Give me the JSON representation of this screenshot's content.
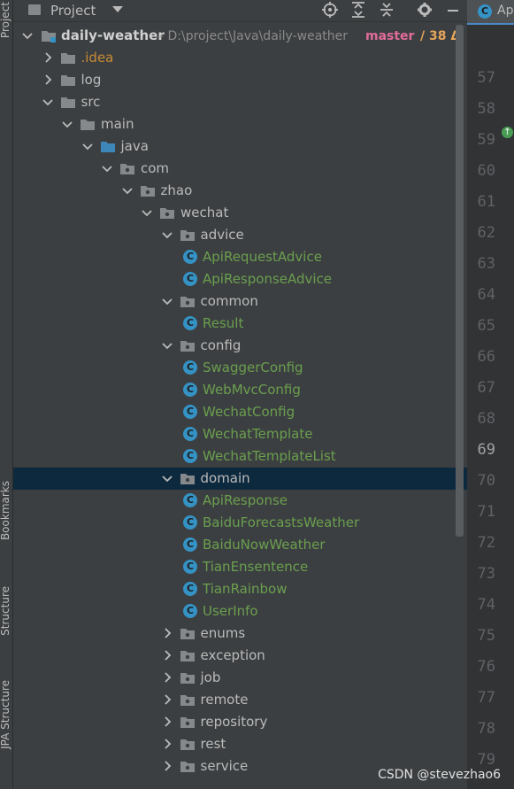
{
  "side_tabs": {
    "project": "Project",
    "bookmarks": "Bookmarks",
    "structure": "Structure",
    "jpa_structure": "JPA Structure"
  },
  "toolbar": {
    "title": "Project",
    "icons": [
      "locate-icon",
      "expand-all-icon",
      "collapse-all-icon",
      "gear-icon",
      "hide-icon"
    ]
  },
  "root": {
    "name": "daily-weather",
    "path": " - D:\\project\\Java\\daily-weather",
    "branch": "master",
    "changes": "/ 38 Δ"
  },
  "tree": [
    {
      "label": ".idea",
      "type": "folder",
      "depth": 1,
      "expanded": false,
      "color": "orange"
    },
    {
      "label": "log",
      "type": "folder",
      "depth": 1,
      "expanded": false
    },
    {
      "label": "src",
      "type": "folder",
      "depth": 1,
      "expanded": true
    },
    {
      "label": "main",
      "type": "folder",
      "depth": 2,
      "expanded": true
    },
    {
      "label": "java",
      "type": "source",
      "depth": 3,
      "expanded": true
    },
    {
      "label": "com",
      "type": "package",
      "depth": 4,
      "expanded": true
    },
    {
      "label": "zhao",
      "type": "package",
      "depth": 5,
      "expanded": true
    },
    {
      "label": "wechat",
      "type": "package",
      "depth": 6,
      "expanded": true
    },
    {
      "label": "advice",
      "type": "package",
      "depth": 7,
      "expanded": true
    },
    {
      "label": "ApiRequestAdvice",
      "type": "class",
      "depth": 8
    },
    {
      "label": "ApiResponseAdvice",
      "type": "class",
      "depth": 8
    },
    {
      "label": "common",
      "type": "package",
      "depth": 7,
      "expanded": true
    },
    {
      "label": "Result",
      "type": "class",
      "depth": 8
    },
    {
      "label": "config",
      "type": "package",
      "depth": 7,
      "expanded": true
    },
    {
      "label": "SwaggerConfig",
      "type": "class",
      "depth": 8
    },
    {
      "label": "WebMvcConfig",
      "type": "class",
      "depth": 8
    },
    {
      "label": "WechatConfig",
      "type": "class",
      "depth": 8
    },
    {
      "label": "WechatTemplate",
      "type": "class",
      "depth": 8
    },
    {
      "label": "WechatTemplateList",
      "type": "class",
      "depth": 8
    },
    {
      "label": "domain",
      "type": "package",
      "depth": 7,
      "expanded": true,
      "selected": true
    },
    {
      "label": "ApiResponse",
      "type": "class",
      "depth": 8
    },
    {
      "label": "BaiduForecastsWeather",
      "type": "class",
      "depth": 8
    },
    {
      "label": "BaiduNowWeather",
      "type": "class",
      "depth": 8
    },
    {
      "label": "TianEnsentence",
      "type": "class",
      "depth": 8
    },
    {
      "label": "TianRainbow",
      "type": "class",
      "depth": 8
    },
    {
      "label": "UserInfo",
      "type": "class",
      "depth": 8
    },
    {
      "label": "enums",
      "type": "package",
      "depth": 7,
      "expanded": false
    },
    {
      "label": "exception",
      "type": "package",
      "depth": 7,
      "expanded": false
    },
    {
      "label": "job",
      "type": "package",
      "depth": 7,
      "expanded": false
    },
    {
      "label": "remote",
      "type": "package",
      "depth": 7,
      "expanded": false
    },
    {
      "label": "repository",
      "type": "package",
      "depth": 7,
      "expanded": false
    },
    {
      "label": "rest",
      "type": "package",
      "depth": 7,
      "expanded": false
    },
    {
      "label": "service",
      "type": "package",
      "depth": 7,
      "expanded": false
    }
  ],
  "editor": {
    "tab_label": "Ap",
    "current_line": "69",
    "line_numbers": [
      "57",
      "58",
      "59",
      "60",
      "61",
      "62",
      "63",
      "64",
      "65",
      "66",
      "67",
      "68",
      "69",
      "70",
      "71",
      "72",
      "73",
      "74",
      "75",
      "76",
      "77",
      "78",
      "79"
    ]
  },
  "watermark": "CSDN @stevezhao6",
  "colors": {
    "selection": "#0d293e",
    "class_green": "#6a9f4e",
    "class_icon": "#3592c4",
    "branch": "#e06c9a",
    "changes": "#e5a55b"
  }
}
